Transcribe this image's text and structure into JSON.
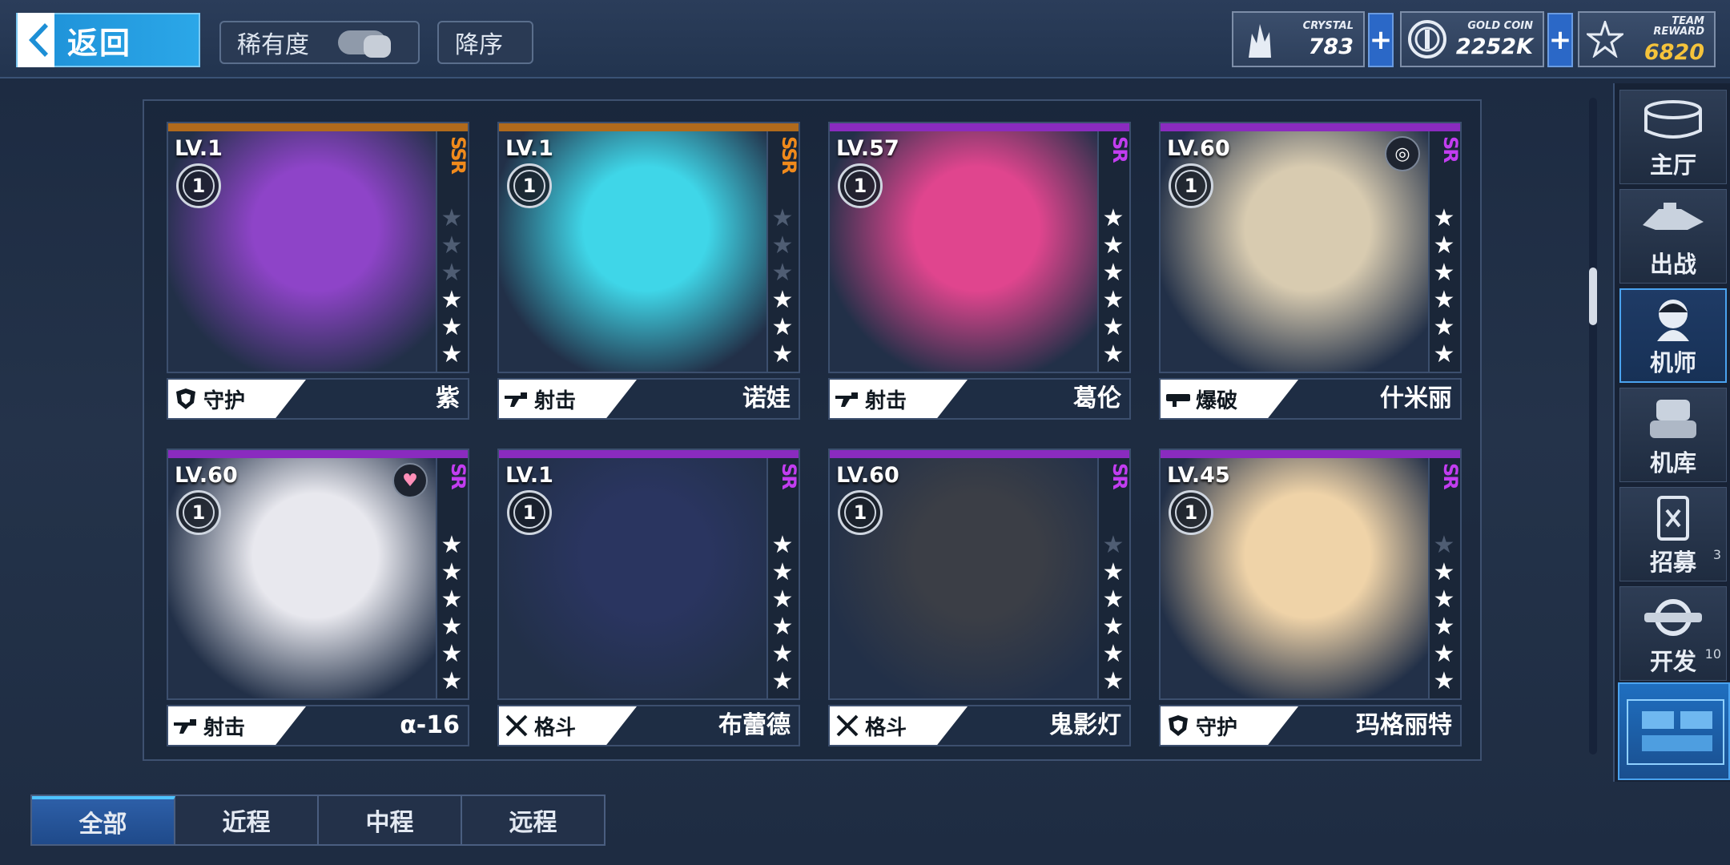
{
  "topbar": {
    "back_label": "返回",
    "sort_rarity": "稀有度",
    "sort_order": "降序"
  },
  "resources": [
    {
      "key": "CRYSTAL",
      "value": "783"
    },
    {
      "key": "GOLD COIN",
      "value": "2252K"
    },
    {
      "key": "TEAM REWARD",
      "value": "6820",
      "color": "#f5c33b"
    }
  ],
  "cards": [
    {
      "level": "LV.1",
      "rank": "1",
      "rarity": "SSR",
      "rarity_color": "#f08a1c",
      "bar_color": "#b06a1c",
      "stars_filled": 3,
      "stars_total": 6,
      "role": "守护",
      "role_icon": "shield-icon",
      "name": "紫",
      "art": "#8e44c8",
      "badge": ""
    },
    {
      "level": "LV.1",
      "rank": "1",
      "rarity": "SSR",
      "rarity_color": "#f08a1c",
      "bar_color": "#b06a1c",
      "stars_filled": 3,
      "stars_total": 6,
      "role": "射击",
      "role_icon": "rifle-icon",
      "name": "诺娃",
      "art": "#3fd6e8",
      "badge": ""
    },
    {
      "level": "LV.57",
      "rank": "1",
      "rarity": "SR",
      "rarity_color": "#c23df0",
      "bar_color": "#8a2bbf",
      "stars_filled": 6,
      "stars_total": 6,
      "role": "射击",
      "role_icon": "rifle-icon",
      "name": "葛伦",
      "art": "#e0458e",
      "badge": ""
    },
    {
      "level": "LV.60",
      "rank": "1",
      "rarity": "SR",
      "rarity_color": "#c23df0",
      "bar_color": "#8a2bbf",
      "stars_filled": 6,
      "stars_total": 6,
      "role": "爆破",
      "role_icon": "launcher-icon",
      "name": "什米丽",
      "art": "#d8cbb0",
      "badge": "ring-icon"
    },
    {
      "level": "LV.60",
      "rank": "1",
      "rarity": "SR",
      "rarity_color": "#c23df0",
      "bar_color": "#8a2bbf",
      "stars_filled": 6,
      "stars_total": 6,
      "role": "射击",
      "role_icon": "rifle-icon",
      "name": "α-16",
      "art": "#e8e8ee",
      "badge": "heart-icon"
    },
    {
      "level": "LV.1",
      "rank": "1",
      "rarity": "SR",
      "rarity_color": "#c23df0",
      "bar_color": "#8a2bbf",
      "stars_filled": 6,
      "stars_total": 6,
      "role": "格斗",
      "role_icon": "swords-icon",
      "name": "布蕾德",
      "art": "#2a3560",
      "badge": ""
    },
    {
      "level": "LV.60",
      "rank": "1",
      "rarity": "SR",
      "rarity_color": "#c23df0",
      "bar_color": "#8a2bbf",
      "stars_filled": 5,
      "stars_total": 6,
      "role": "格斗",
      "role_icon": "swords-icon",
      "name": "鬼影灯",
      "art": "#3b3e46",
      "badge": ""
    },
    {
      "level": "LV.45",
      "rank": "1",
      "rarity": "SR",
      "rarity_color": "#c23df0",
      "bar_color": "#8a2bbf",
      "stars_filled": 5,
      "stars_total": 6,
      "role": "守护",
      "role_icon": "shield-icon",
      "name": "玛格丽特",
      "art": "#efd3a8",
      "badge": ""
    }
  ],
  "nav": [
    {
      "label": "主厅",
      "icon": "hall-icon",
      "count": ""
    },
    {
      "label": "出战",
      "icon": "sortie-icon",
      "count": ""
    },
    {
      "label": "机师",
      "icon": "pilot-icon",
      "count": "",
      "active": true
    },
    {
      "label": "机库",
      "icon": "hangar-icon",
      "count": ""
    },
    {
      "label": "招募",
      "icon": "recruit-icon",
      "count": "3"
    },
    {
      "label": "开发",
      "icon": "develop-icon",
      "count": "10"
    }
  ],
  "tabs": [
    {
      "label": "全部",
      "active": true
    },
    {
      "label": "近程"
    },
    {
      "label": "中程"
    },
    {
      "label": "远程"
    }
  ]
}
